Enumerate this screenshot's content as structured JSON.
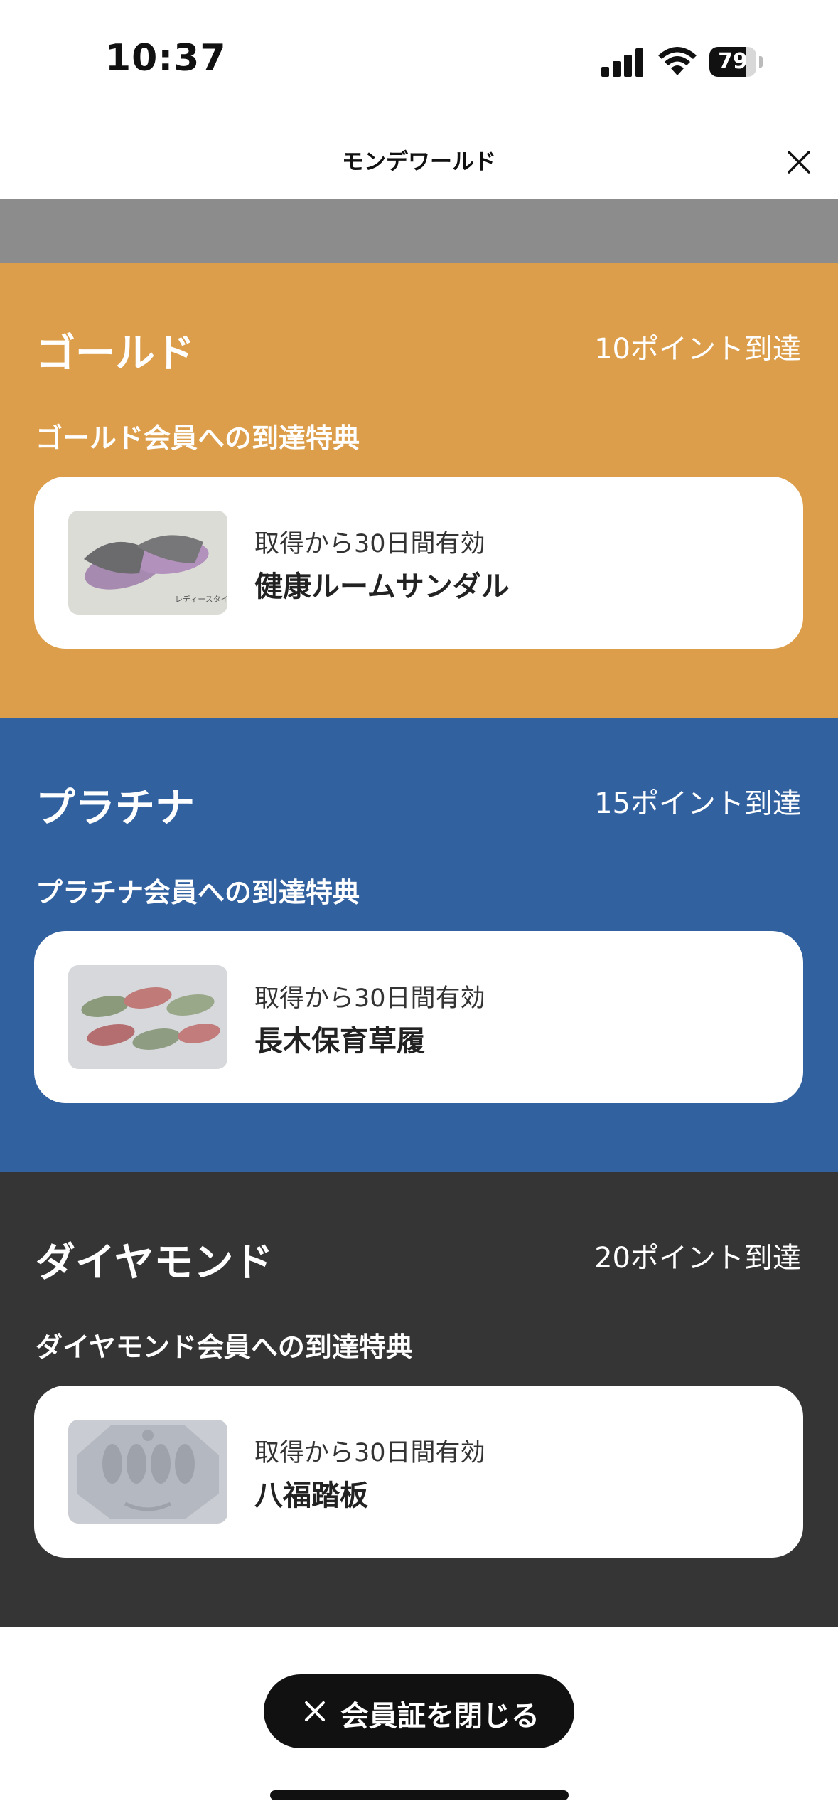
{
  "status": {
    "time": "10:37",
    "battery": "79",
    "battery_level": 0.79
  },
  "header": {
    "title": "モンデワールド"
  },
  "tiers": [
    {
      "name": "ゴールド",
      "reach": "10ポイント到達",
      "subtitle": "ゴールド会員への到達特典",
      "bg": "#DC9E4A",
      "reward": {
        "validity": "取得から30日間有効",
        "title": "健康ルームサンダル",
        "image_caption": "レディースタイプ"
      }
    },
    {
      "name": "プラチナ",
      "reach": "15ポイント到達",
      "subtitle": "プラチナ会員への到達特典",
      "bg": "#3261A0",
      "reward": {
        "validity": "取得から30日間有効",
        "title": "長木保育草履"
      }
    },
    {
      "name": "ダイヤモンド",
      "reach": "20ポイント到達",
      "subtitle": "ダイヤモンド会員への到達特典",
      "bg": "#353535",
      "reward": {
        "validity": "取得から30日間有効",
        "title": "八福踏板"
      }
    }
  ],
  "footer": {
    "close_label": "会員証を閉じる"
  }
}
